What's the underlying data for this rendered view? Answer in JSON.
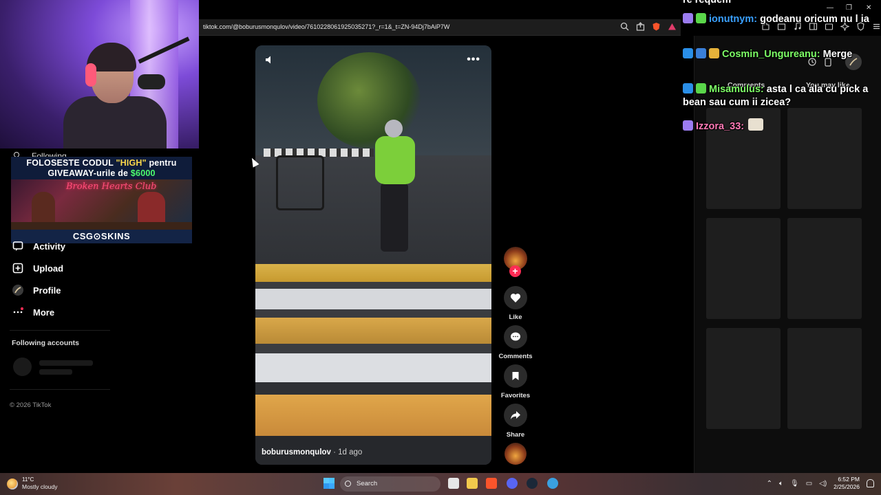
{
  "browser": {
    "url": "tiktok.com/@boburusmonqulov/video/7610228061925035271?_r=1&_t=ZN-94Dj7bAiP7W"
  },
  "promo": {
    "line1_a": "FOLOSESTE CODUL ",
    "line1_b": "\"HIGH\"",
    "line1_c": " pentru",
    "line2_a": "GIVEAWAY-urile de ",
    "line2_b": "$6000",
    "neon_text": "Broken Hearts Club",
    "brand": "CSG⊙SKINS"
  },
  "sidebar": {
    "partial_item": "Following",
    "items": [
      {
        "label": "Activity",
        "icon": "activity-icon"
      },
      {
        "label": "Upload",
        "icon": "upload-icon"
      },
      {
        "label": "Profile",
        "icon": "profile-avatar-icon"
      },
      {
        "label": "More",
        "icon": "more-dots-icon"
      }
    ],
    "following_title": "Following accounts",
    "copyright": "© 2026 TikTok"
  },
  "video": {
    "author": "boburusmonqulov",
    "posted": " · 1d ago",
    "volume_icon": "volume-icon",
    "more_icon": "more-options-icon"
  },
  "actions": {
    "like": "Like",
    "comments": "Comments",
    "favorites": "Favorites",
    "share": "Share"
  },
  "right_panel": {
    "tab_comments": "Comments",
    "tab_you_may_like": "You may like"
  },
  "chat": {
    "partial_top": "re requem",
    "messages": [
      {
        "user": "ionutnym:",
        "text": " godeanu oricum nu l ia",
        "color": "#3aa0ff"
      },
      {
        "user": "Cosmin_Ungureanu:",
        "text": " Merge",
        "color": "#7dff66"
      },
      {
        "user": "Misamulus:",
        "text": " asta l ca ala cu pick a bean sau cum ii zicea?",
        "color": "#7dff66"
      },
      {
        "user": "Izzora_33:",
        "text": "",
        "color": "#ff7ab6"
      }
    ]
  },
  "taskbar": {
    "temp": "11°C",
    "weather": "Mostly cloudy",
    "search": "Search",
    "time": "6:52 PM",
    "date": "2/25/2026"
  },
  "colors": {
    "accent_red": "#fe2c55",
    "background": "#000000"
  }
}
